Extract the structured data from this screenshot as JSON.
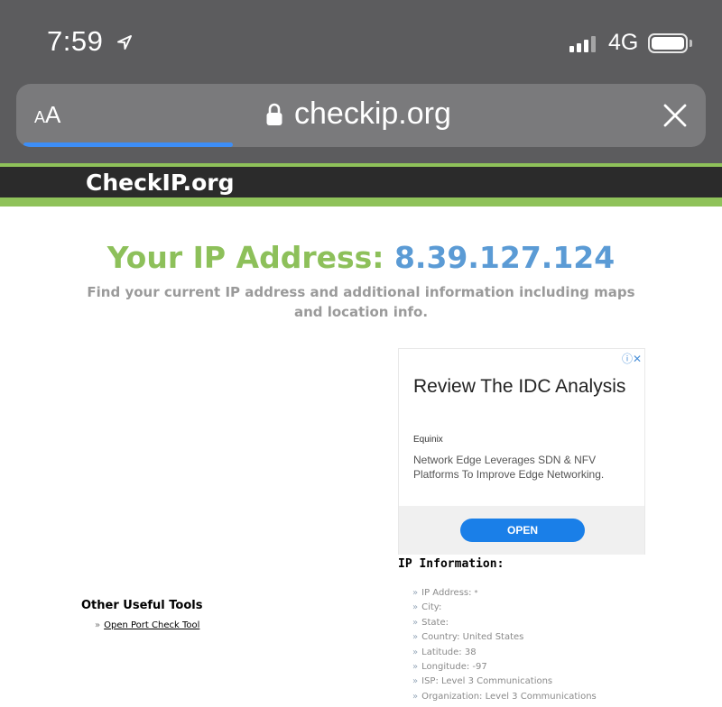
{
  "status_bar": {
    "time": "7:59",
    "network": "4G"
  },
  "browser": {
    "text_size_button": "AA",
    "url": "checkip.org",
    "progress_fraction": 0.31
  },
  "site": {
    "brand": "CheckIP.org",
    "headline_label": "Your IP Address:",
    "ip_address": "8.39.127.124",
    "subtitle": "Find your current IP address and additional information including maps and location info."
  },
  "ad": {
    "title": "Review The IDC Analysis",
    "advertiser": "Equinix",
    "body": "Network Edge Leverages SDN & NFV Platforms To Improve Edge Networking.",
    "cta": "OPEN"
  },
  "ip_information": {
    "title": "IP Information:",
    "items": [
      "IP Address:",
      "City:",
      "State:",
      "Country: United States",
      "Latitude: 38",
      "Longitude: -97",
      "ISP: Level 3 Communications",
      "Organization: Level 3 Communications"
    ],
    "footnote_mark": "*"
  },
  "tools": {
    "title": "Other Useful Tools",
    "items": [
      "Open Port Check Tool"
    ]
  },
  "colors": {
    "chrome": "#5c5c5e",
    "accent_green": "#8dc05a",
    "ip_blue": "#5b9bd5",
    "progress_blue": "#3d8ef7"
  }
}
